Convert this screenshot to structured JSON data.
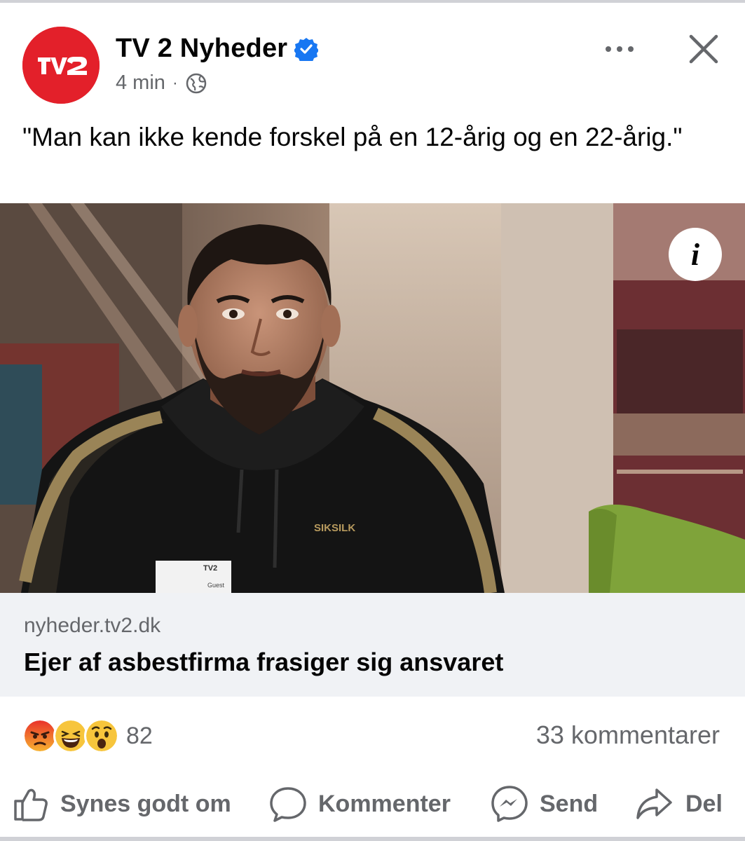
{
  "post": {
    "page_name": "TV 2 Nyheder",
    "time_ago": "4 min",
    "separator": "·",
    "audience_icon": "globe-icon",
    "text": "\"Man kan ikke kende forskel på en 12-årig og en 22-årig.\""
  },
  "avatar": {
    "logo_text": "TV2",
    "brand_color": "#e3202a"
  },
  "media": {
    "alt": "Man in black SIKSILK hoodie with bead, interviewed indoors",
    "info_label": "i",
    "hoodie_brand": "SIKSILK",
    "badge_label": "Guest"
  },
  "link": {
    "domain": "nyheder.tv2.dk",
    "title": "Ejer af asbestfirma frasiger sig ansvaret"
  },
  "reactions": {
    "icons": [
      "angry-emoji-icon",
      "haha-emoji-icon",
      "wow-emoji-icon"
    ],
    "count": "82",
    "comments": "33 kommentarer"
  },
  "actions": {
    "like": "Synes godt om",
    "comment": "Kommenter",
    "send": "Send",
    "share": "Del"
  },
  "colors": {
    "secondary_text": "#65676b",
    "verified_blue": "#1877f2",
    "link_bg": "#f0f2f5"
  }
}
